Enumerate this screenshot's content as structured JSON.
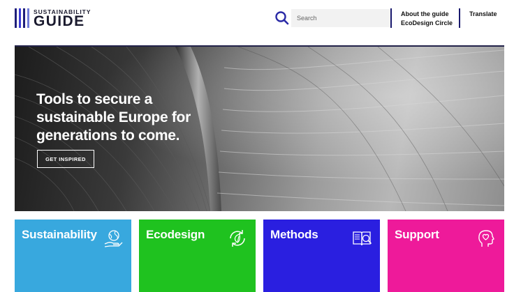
{
  "header": {
    "logo": {
      "top_text": "SUSTAINABILITY",
      "main_text": "GUIDE",
      "bar_colors": [
        "#1f1f7a",
        "#3a3ad6",
        "#1f1f7a",
        "#6f7bd9"
      ]
    },
    "search": {
      "placeholder": "Search",
      "value": ""
    },
    "nav": {
      "about": "About the guide",
      "ecodesign_circle": "EcoDesign Circle",
      "translate": "Translate"
    }
  },
  "hero": {
    "title": "Tools to secure a sustainable Europe for generations to come.",
    "button": "GET INSPIRED"
  },
  "tiles": [
    {
      "label": "Sustainability",
      "color": "#38a8de",
      "icon": "hand-globe-icon"
    },
    {
      "label": "Ecodesign",
      "color": "#1fc21f",
      "icon": "recycle-leaf-icon"
    },
    {
      "label": "Methods",
      "color": "#2a1fe0",
      "icon": "book-magnifier-icon"
    },
    {
      "label": "Support",
      "color": "#ee1a9a",
      "icon": "head-heart-icon"
    }
  ],
  "colors": {
    "accent": "#1a1a6e",
    "search_icon": "#2a2aa6"
  }
}
